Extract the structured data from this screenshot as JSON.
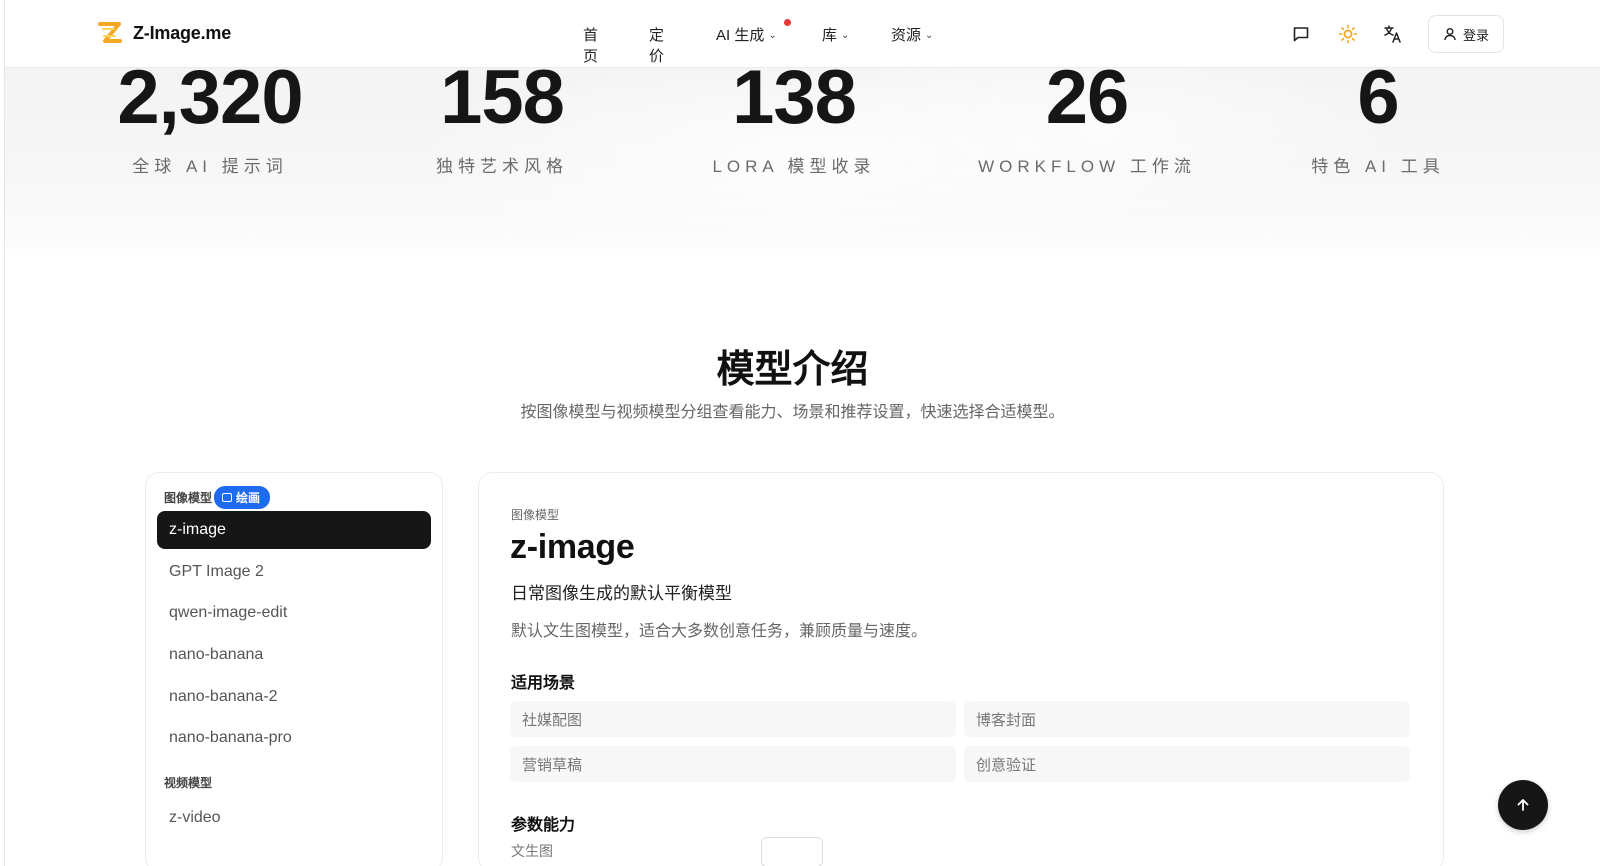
{
  "header": {
    "brand": "Z-Image.me",
    "nav": [
      {
        "label": "首页",
        "has_dropdown": false
      },
      {
        "label": "定价",
        "has_dropdown": false
      },
      {
        "label": "AI 生成",
        "has_dropdown": true,
        "has_dot": true
      },
      {
        "label": "库",
        "has_dropdown": true
      },
      {
        "label": "资源",
        "has_dropdown": true
      }
    ],
    "chevron": "⌄",
    "icons": [
      "chat-icon",
      "sun-icon",
      "translate-icon"
    ],
    "login_label": "登录",
    "accent_color": "#f5a623"
  },
  "stats": [
    {
      "value": "2,320",
      "label": "全球 AI 提示词"
    },
    {
      "value": "158",
      "label": "独特艺术风格"
    },
    {
      "value": "138",
      "label": "LORA 模型收录"
    },
    {
      "value": "26",
      "label": "WORKFLOW 工作流"
    },
    {
      "value": "6",
      "label": "特色 AI 工具"
    }
  ],
  "section": {
    "title": "模型介绍",
    "subtitle": "按图像模型与视频模型分组查看能力、场景和推荐设置，快速选择合适模型。"
  },
  "sidebar": {
    "image_group_label": "图像模型",
    "image_badge": "绘画",
    "image_models": [
      "z-image",
      "GPT Image 2",
      "qwen-image-edit",
      "nano-banana",
      "nano-banana-2",
      "nano-banana-pro"
    ],
    "active_model": "z-image",
    "video_group_label": "视频模型",
    "video_models": [
      "z-video"
    ]
  },
  "detail": {
    "category": "图像模型",
    "name": "z-image",
    "tagline": "日常图像生成的默认平衡模型",
    "description": "默认文生图模型，适合大多数创意任务，兼顾质量与速度。",
    "scenes_heading": "适用场景",
    "scenes": [
      "社媒配图",
      "博客封面",
      "营销草稿",
      "创意验证"
    ],
    "params_heading": "参数能力",
    "param_first": "文生图"
  },
  "colors": {
    "badge": "#1e6bf0",
    "active_item": "#161616",
    "nav_dot": "#e53935"
  }
}
